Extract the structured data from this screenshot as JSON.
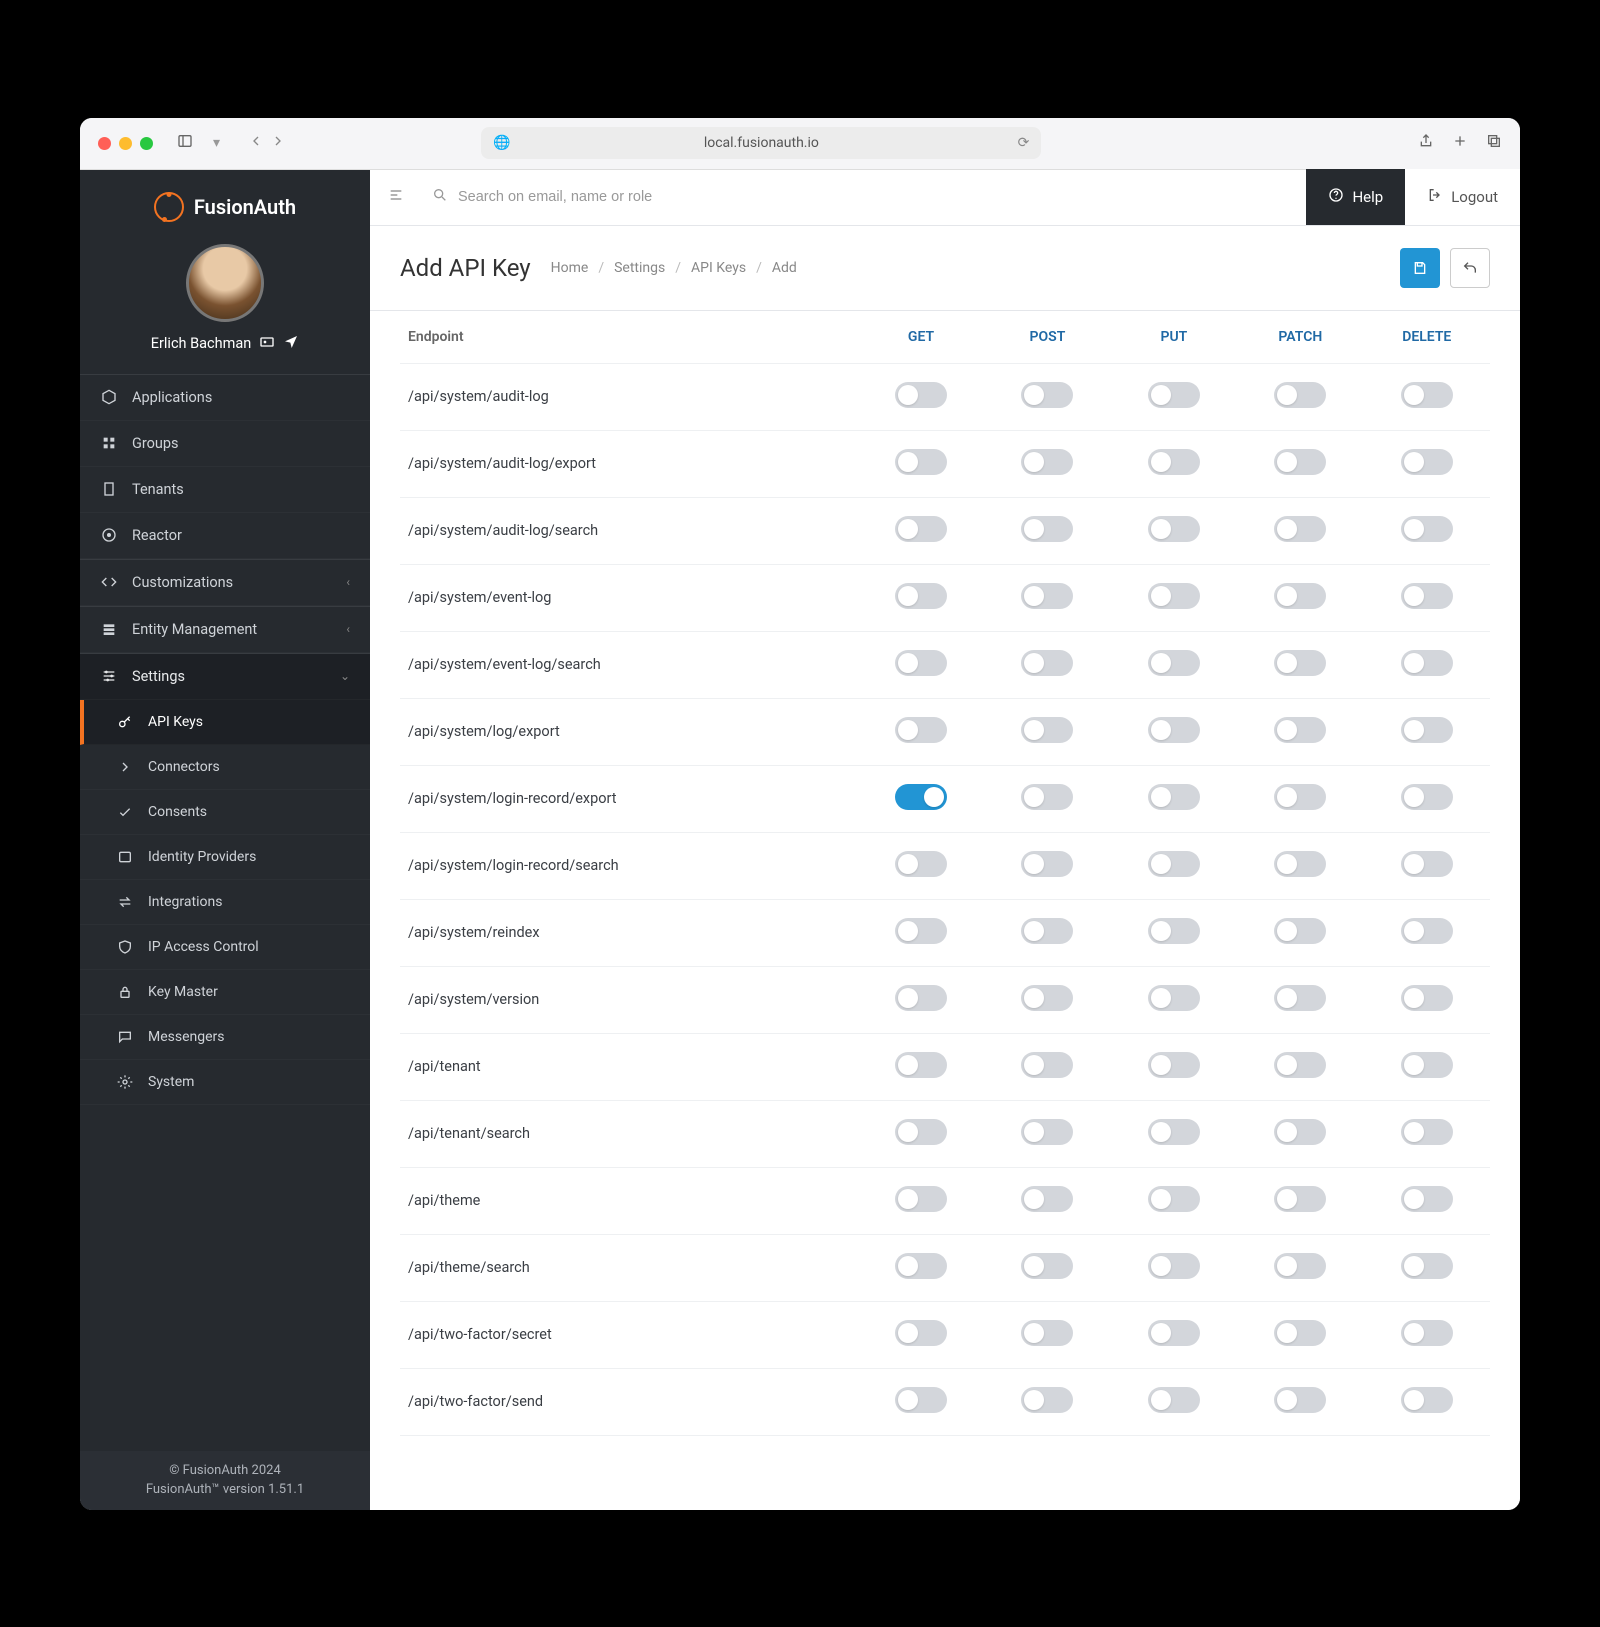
{
  "browser": {
    "address": "local.fusionauth.io"
  },
  "brand": "FusionAuth",
  "user": {
    "name": "Erlich Bachman"
  },
  "sidebar": {
    "items": [
      {
        "label": "Applications"
      },
      {
        "label": "Groups"
      },
      {
        "label": "Tenants"
      },
      {
        "label": "Reactor"
      },
      {
        "label": "Customizations"
      },
      {
        "label": "Entity Management"
      },
      {
        "label": "Settings"
      }
    ],
    "settings_sub": [
      {
        "label": "API Keys"
      },
      {
        "label": "Connectors"
      },
      {
        "label": "Consents"
      },
      {
        "label": "Identity Providers"
      },
      {
        "label": "Integrations"
      },
      {
        "label": "IP Access Control"
      },
      {
        "label": "Key Master"
      },
      {
        "label": "Messengers"
      },
      {
        "label": "System"
      }
    ],
    "footer_line1": "© FusionAuth 2024",
    "footer_line2": "FusionAuth™ version 1.51.1"
  },
  "topbar": {
    "search_placeholder": "Search on email, name or role",
    "help_label": "Help",
    "logout_label": "Logout"
  },
  "page": {
    "title": "Add API Key",
    "breadcrumb": [
      "Home",
      "Settings",
      "API Keys",
      "Add"
    ]
  },
  "table": {
    "endpoint_header": "Endpoint",
    "methods": [
      "GET",
      "POST",
      "PUT",
      "PATCH",
      "DELETE"
    ],
    "rows": [
      {
        "endpoint": "/api/system/audit-log",
        "on": []
      },
      {
        "endpoint": "/api/system/audit-log/export",
        "on": []
      },
      {
        "endpoint": "/api/system/audit-log/search",
        "on": []
      },
      {
        "endpoint": "/api/system/event-log",
        "on": []
      },
      {
        "endpoint": "/api/system/event-log/search",
        "on": []
      },
      {
        "endpoint": "/api/system/log/export",
        "on": []
      },
      {
        "endpoint": "/api/system/login-record/export",
        "on": [
          "GET"
        ]
      },
      {
        "endpoint": "/api/system/login-record/search",
        "on": []
      },
      {
        "endpoint": "/api/system/reindex",
        "on": []
      },
      {
        "endpoint": "/api/system/version",
        "on": []
      },
      {
        "endpoint": "/api/tenant",
        "on": []
      },
      {
        "endpoint": "/api/tenant/search",
        "on": []
      },
      {
        "endpoint": "/api/theme",
        "on": []
      },
      {
        "endpoint": "/api/theme/search",
        "on": []
      },
      {
        "endpoint": "/api/two-factor/secret",
        "on": []
      },
      {
        "endpoint": "/api/two-factor/send",
        "on": []
      }
    ]
  }
}
